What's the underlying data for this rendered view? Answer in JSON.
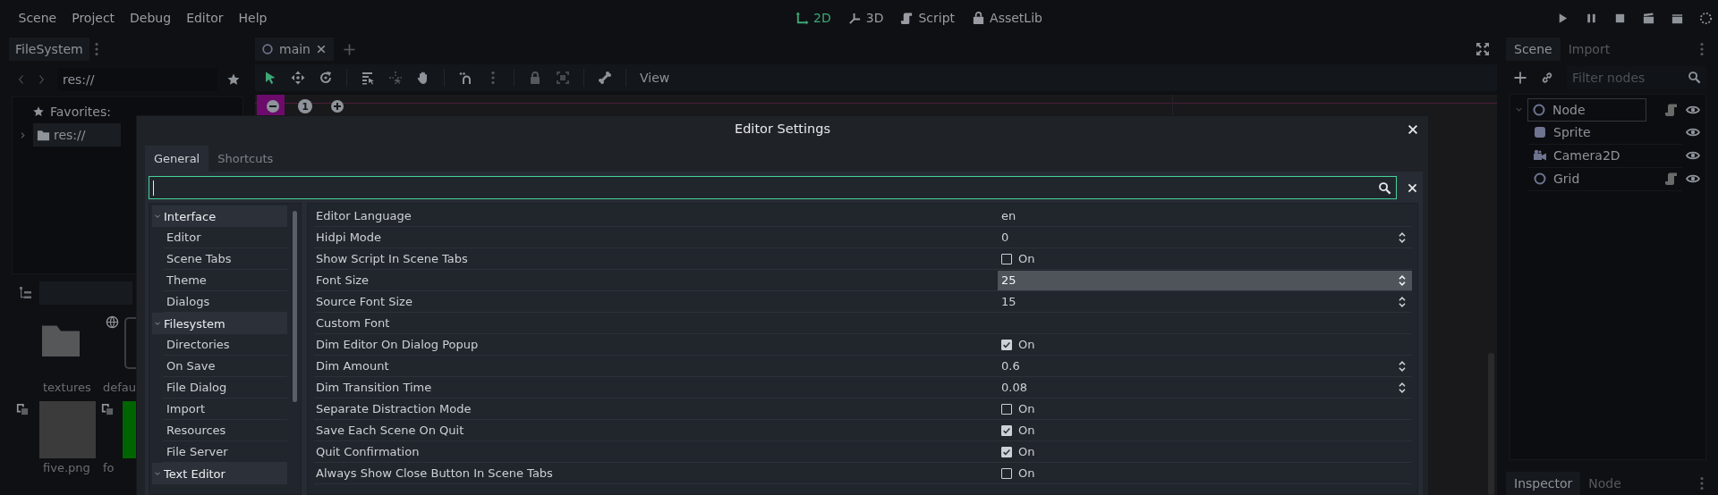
{
  "menu_bar": {
    "menus": [
      "Scene",
      "Project",
      "Debug",
      "Editor",
      "Help"
    ],
    "workspaces": [
      {
        "label": "2D",
        "kind": "planar",
        "selected": true
      },
      {
        "label": "3D",
        "kind": "spatial",
        "selected": false
      },
      {
        "label": "Script",
        "kind": "script",
        "selected": false
      },
      {
        "label": "AssetLib",
        "kind": "assetlib",
        "selected": false
      }
    ]
  },
  "filesystem_dock": {
    "tabs": [
      {
        "label": "FileSystem",
        "selected": true
      }
    ],
    "path": "res://",
    "favorites": "Favorites:",
    "tree": [
      {
        "label": "res://",
        "selected": true,
        "expanded": false
      }
    ],
    "files": [
      {
        "name": "textures",
        "kind": "folder"
      },
      {
        "name": "defau",
        "kind": "resource"
      },
      {
        "name": "five.png",
        "kind": "image",
        "color": "#3b3b3b"
      },
      {
        "name": "fo",
        "kind": "image",
        "color": "#006400"
      }
    ]
  },
  "scene_view": {
    "tabs": [
      {
        "label": "main"
      }
    ],
    "view_menu": "View",
    "zoom_reset": "1"
  },
  "scene_dock": {
    "tabs": [
      {
        "label": "Scene",
        "selected": true
      },
      {
        "label": "Import",
        "selected": false
      }
    ],
    "filter_placeholder": "Filter nodes",
    "tree": [
      {
        "name": "Node",
        "kind": "node",
        "selected": true,
        "expanded": true,
        "script": true,
        "visible": true,
        "children": [
          {
            "name": "Sprite",
            "kind": "sprite",
            "selected": false,
            "script": false,
            "visible": true
          },
          {
            "name": "Camera2D",
            "kind": "camera",
            "selected": false,
            "script": false,
            "visible": true
          },
          {
            "name": "Grid",
            "kind": "node",
            "selected": false,
            "script": true,
            "visible": true
          }
        ]
      }
    ],
    "bottom_tabs": [
      {
        "label": "Inspector",
        "selected": true
      },
      {
        "label": "Node",
        "selected": false
      }
    ]
  },
  "editor_settings": {
    "title": "Editor Settings",
    "tabs": [
      {
        "label": "General",
        "selected": true
      },
      {
        "label": "Shortcuts",
        "selected": false
      }
    ],
    "search": {
      "focused": true
    },
    "sections": [
      {
        "label": "Interface",
        "expanded": true,
        "children": [
          {
            "label": "Editor",
            "selected": false
          },
          {
            "label": "Scene Tabs",
            "selected": false
          },
          {
            "label": "Theme",
            "selected": false
          },
          {
            "label": "Dialogs",
            "selected": false
          }
        ]
      },
      {
        "label": "Filesystem",
        "expanded": true,
        "children": [
          {
            "label": "Directories",
            "selected": false
          },
          {
            "label": "On Save",
            "selected": false
          },
          {
            "label": "File Dialog",
            "selected": false
          },
          {
            "label": "Import",
            "selected": false
          },
          {
            "label": "Resources",
            "selected": false
          },
          {
            "label": "File Server",
            "selected": false
          }
        ]
      },
      {
        "label": "Text Editor",
        "expanded": true
      }
    ],
    "properties": [
      {
        "label": "Editor Language",
        "kind": "text",
        "value": "en",
        "selected": false
      },
      {
        "label": "Hidpi Mode",
        "kind": "number",
        "value": "0",
        "selected": false
      },
      {
        "label": "Show Script In Scene Tabs",
        "kind": "check",
        "checked": false,
        "value": "On",
        "selected": false
      },
      {
        "label": "Font Size",
        "kind": "number",
        "value": "25",
        "selected": true
      },
      {
        "label": "Source Font Size",
        "kind": "number",
        "value": "15",
        "selected": false
      },
      {
        "label": "Custom Font",
        "kind": "resource",
        "selected": false
      },
      {
        "label": "Dim Editor On Dialog Popup",
        "kind": "check",
        "checked": true,
        "value": "On",
        "selected": false
      },
      {
        "label": "Dim Amount",
        "kind": "number",
        "value": "0.6",
        "selected": false
      },
      {
        "label": "Dim Transition Time",
        "kind": "number",
        "value": "0.08",
        "selected": false
      },
      {
        "label": "Separate Distraction Mode",
        "kind": "check",
        "checked": false,
        "value": "On",
        "selected": false
      },
      {
        "label": "Save Each Scene On Quit",
        "kind": "check",
        "checked": true,
        "value": "On",
        "selected": false
      },
      {
        "label": "Quit Confirmation",
        "kind": "check",
        "checked": true,
        "value": "On",
        "selected": false
      },
      {
        "label": "Always Show Close Button In Scene Tabs",
        "kind": "check",
        "checked": false,
        "value": "On",
        "selected": false
      }
    ]
  }
}
